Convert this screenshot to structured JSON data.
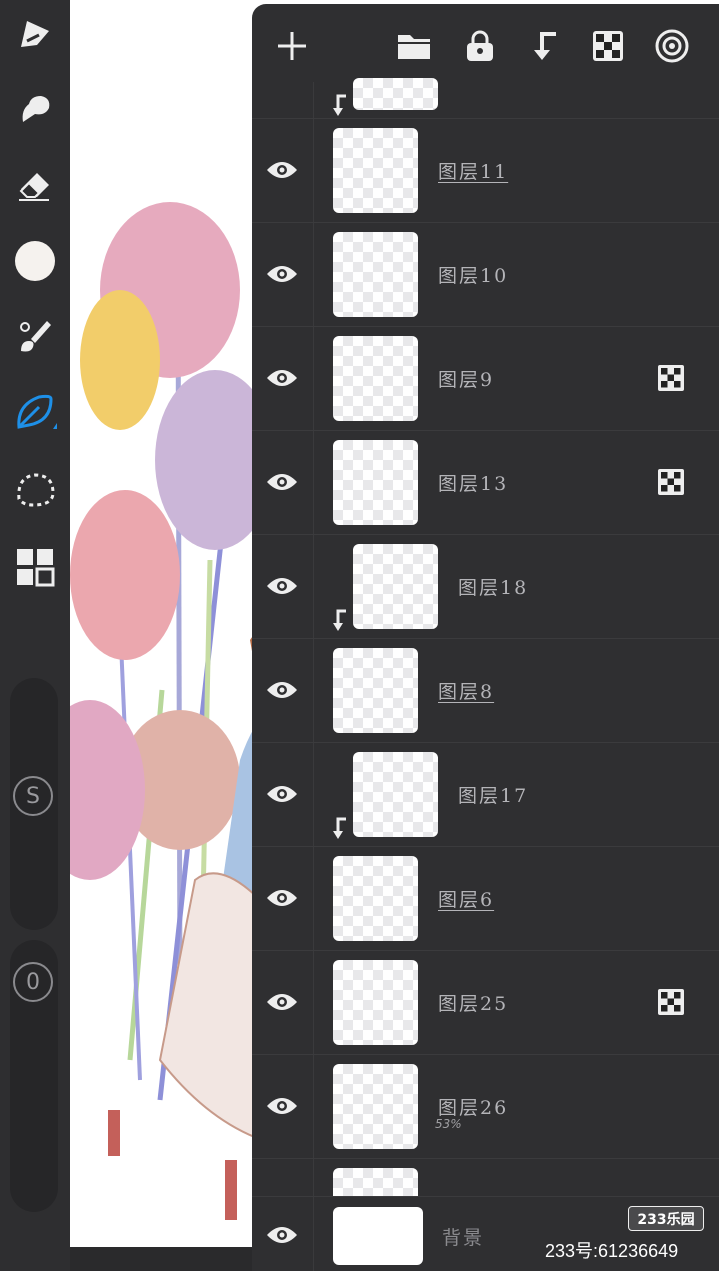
{
  "toolbar": {
    "tools": [
      {
        "name": "draw-tool-icon"
      },
      {
        "name": "smudge-tool-icon"
      },
      {
        "name": "eraser-tool-icon"
      },
      {
        "name": "color-swatch-icon"
      },
      {
        "name": "brush-library-icon"
      },
      {
        "name": "leaf-brush-icon"
      },
      {
        "name": "lasso-selection-icon"
      },
      {
        "name": "layers-grid-icon"
      }
    ],
    "size_label": "S",
    "opacity_label": "0",
    "active_color": "#1e90e8",
    "swatch_color": "#f5f2ee"
  },
  "panel": {
    "top_actions": [
      "add-layer",
      "folder",
      "lock",
      "merge-down",
      "alpha-lock",
      "layer-settings"
    ],
    "layers": [
      {
        "name": "图层11",
        "underlined": true,
        "alpha_lock": false,
        "clipped": false,
        "opacity": ""
      },
      {
        "name": "图层10",
        "underlined": false,
        "alpha_lock": false,
        "clipped": false,
        "opacity": ""
      },
      {
        "name": "图层9",
        "underlined": false,
        "alpha_lock": true,
        "clipped": false,
        "opacity": ""
      },
      {
        "name": "图层13",
        "underlined": false,
        "alpha_lock": true,
        "clipped": false,
        "opacity": ""
      },
      {
        "name": "图层18",
        "underlined": false,
        "alpha_lock": false,
        "clipped": true,
        "opacity": ""
      },
      {
        "name": "图层8",
        "underlined": true,
        "alpha_lock": false,
        "clipped": false,
        "opacity": ""
      },
      {
        "name": "图层17",
        "underlined": false,
        "alpha_lock": false,
        "clipped": true,
        "opacity": ""
      },
      {
        "name": "图层6",
        "underlined": true,
        "alpha_lock": false,
        "clipped": false,
        "opacity": ""
      },
      {
        "name": "图层25",
        "underlined": false,
        "alpha_lock": true,
        "clipped": false,
        "opacity": ""
      },
      {
        "name": "图层26",
        "underlined": false,
        "alpha_lock": false,
        "clipped": false,
        "opacity": "53%"
      }
    ],
    "background": {
      "name": "背景"
    }
  },
  "watermark": {
    "logo": "233乐园",
    "text": "233号:61236649"
  }
}
